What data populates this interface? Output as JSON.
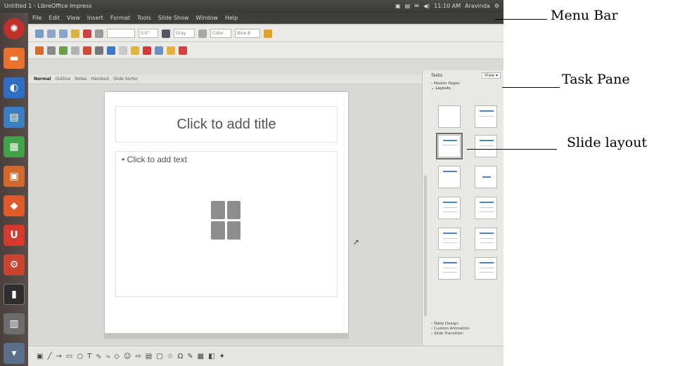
{
  "window": {
    "title": "Untitled 1 - LibreOffice Impress",
    "status": [
      "▣",
      "▤",
      "✉",
      "◀)",
      "11:10 AM",
      "Aravinda",
      "⚙"
    ]
  },
  "menubar": {
    "items": [
      "File",
      "Edit",
      "View",
      "Insert",
      "Format",
      "Tools",
      "Slide Show",
      "Window",
      "Help"
    ]
  },
  "toolbar": {
    "zoom": "0.0\"",
    "gray": "Gray",
    "color": "Color",
    "blue": "Blue 8"
  },
  "view_tabs": [
    "Normal",
    "Outline",
    "Notes",
    "Handout",
    "Slide Sorter"
  ],
  "slide": {
    "title_placeholder": "Click to add title",
    "content_placeholder": "• Click to add text"
  },
  "task_pane": {
    "title": "Tasks",
    "view_label": "View ▾",
    "master_pages": "› Master Pages",
    "layouts": "⌄ Layouts",
    "bottom_sections": [
      "› Table Design",
      "› Custom Animation",
      "› Slide Transition"
    ]
  },
  "callouts": {
    "menu_bar": "Menu Bar",
    "task_pane": "Task Pane",
    "slide_layout": "Slide layout"
  },
  "colors": {
    "title_bar": "#3a3935",
    "launcher": "#4b3f3d",
    "accent_blue": "#4d86c8",
    "background": "#d7d7d4"
  }
}
